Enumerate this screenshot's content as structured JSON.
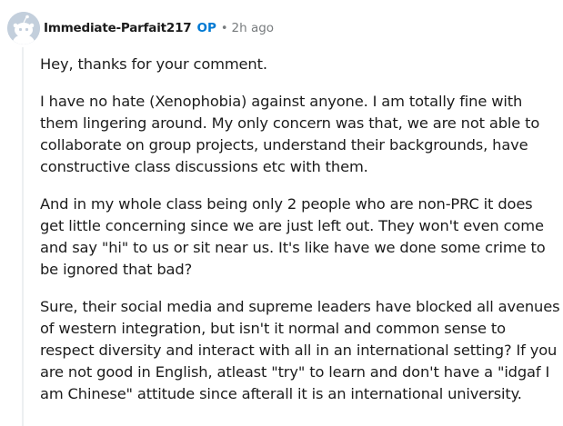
{
  "comment": {
    "author": "Immediate-Parfait217",
    "op_badge": "OP",
    "separator": "•",
    "time": "2h ago",
    "avatar_icon": "reddit-snoo-avatar-icon",
    "paragraphs": [
      "Hey, thanks for your comment.",
      "I have no hate (Xenophobia) against anyone. I am totally fine with them lingering around. My only concern was that, we are not able to collaborate on group projects, understand their backgrounds, have constructive class discussions etc with them.",
      "And in my whole class being only 2 people who are non-PRC it does get little concerning since we are just left out. They won't even come and say \"hi\" to us or sit near us. It's like have we done some crime to be ignored that bad?",
      "Sure, their social media and supreme leaders have blocked all avenues of western integration, but isn't it normal and common sense to respect diversity and interact with all in an international setting? If you are not good in English, atleast \"try\" to learn and don't have a \"idgaf I am Chinese\" attitude since afterall it is an international university."
    ]
  },
  "colors": {
    "text": "#1c1c1c",
    "op": "#0079d3",
    "meta": "#787c7e",
    "thread_line": "#edeff1"
  }
}
